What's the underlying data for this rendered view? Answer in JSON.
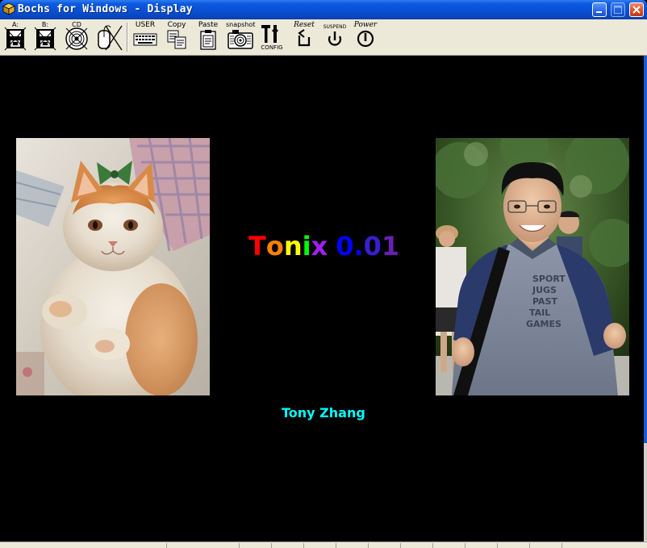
{
  "window": {
    "title": "Bochs for Windows - Display",
    "title_icon": "bochs-cube-icon",
    "controls": [
      {
        "name": "minimize",
        "icon": "minimize-icon",
        "enabled": true
      },
      {
        "name": "maximize",
        "icon": "maximize-icon",
        "enabled": false
      },
      {
        "name": "close",
        "icon": "close-icon",
        "enabled": true
      }
    ]
  },
  "toolbar": {
    "buttons": [
      {
        "id": "floppy-a",
        "caption": "A:",
        "icon": "floppy-drive-icon"
      },
      {
        "id": "floppy-b",
        "caption": "B:",
        "icon": "floppy-drive-icon"
      },
      {
        "id": "cdrom",
        "caption": "CD",
        "icon": "cdrom-icon"
      },
      {
        "id": "mouse",
        "caption": "",
        "icon": "mouse-capture-icon"
      },
      {
        "id": "user",
        "caption": "USER",
        "icon": "keyboard-icon"
      },
      {
        "id": "copy",
        "caption": "Copy",
        "icon": "copy-icon"
      },
      {
        "id": "paste",
        "caption": "Paste",
        "icon": "paste-icon"
      },
      {
        "id": "snapshot",
        "caption": "snapshot",
        "icon": "camera-icon"
      },
      {
        "id": "config",
        "caption": "CONFIG",
        "icon": "config-tools-icon"
      },
      {
        "id": "reset",
        "caption": "Reset",
        "icon": "reset-icon"
      },
      {
        "id": "suspend",
        "caption": "SUSPEND",
        "icon": "suspend-icon"
      },
      {
        "id": "power",
        "caption": "Power",
        "icon": "power-icon"
      }
    ]
  },
  "screen": {
    "background": "#000000",
    "headline": {
      "letters": [
        {
          "ch": "T",
          "color": "#ff0000"
        },
        {
          "ch": "o",
          "color": "#ff8000"
        },
        {
          "ch": "n",
          "color": "#ffff00"
        },
        {
          "ch": "i",
          "color": "#00ff00"
        },
        {
          "ch": "x",
          "color": "#a020f0"
        },
        {
          "ch": " ",
          "color": "#000000"
        },
        {
          "ch": "0",
          "color": "#0000ff"
        },
        {
          "ch": ".",
          "color": "#0000ff"
        },
        {
          "ch": "0",
          "color": "#3a1fd0"
        },
        {
          "ch": "1",
          "color": "#6a1fb0"
        }
      ]
    },
    "author": {
      "text": "Tony Zhang",
      "color": "#00ffff"
    },
    "photos": [
      {
        "id": "cat-photo",
        "subject": "orange and white kitten on quilt"
      },
      {
        "id": "person-photo",
        "subject": "smiling young man with glasses outdoors"
      }
    ]
  }
}
